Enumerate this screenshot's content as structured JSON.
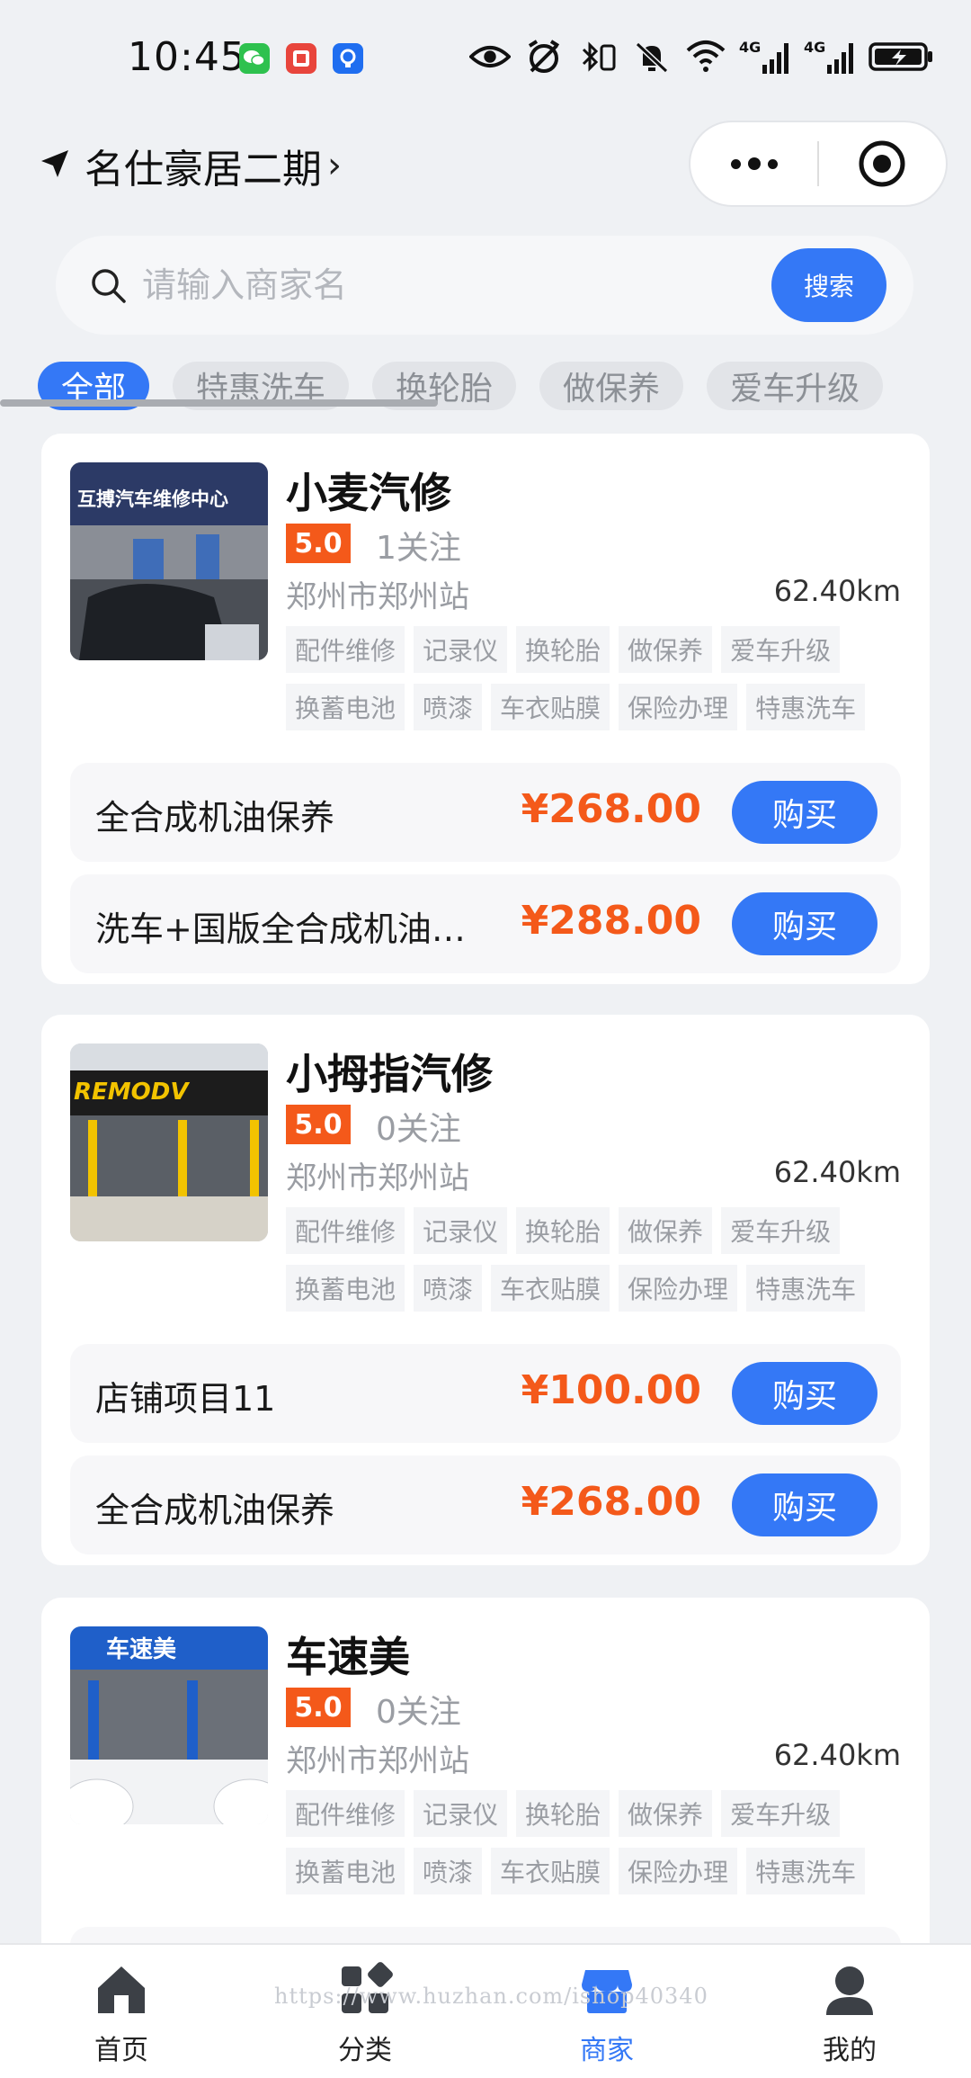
{
  "status_bar": {
    "time": "10:45",
    "app_icons": [
      {
        "name": "wechat-icon",
        "color": "#2ec14e"
      },
      {
        "name": "red-app-icon",
        "color": "#e8453c"
      },
      {
        "name": "blue-app-icon",
        "color": "#1f6ef0"
      }
    ],
    "network": [
      "4G",
      "4G"
    ]
  },
  "header": {
    "location_icon": "navigation-arrow-icon",
    "location_name": "名仕豪居二期",
    "chevron": "›"
  },
  "search": {
    "placeholder": "请输入商家名",
    "button_label": "搜索"
  },
  "categories": [
    {
      "label": "全部",
      "active": true
    },
    {
      "label": "特惠洗车",
      "active": false
    },
    {
      "label": "换轮胎",
      "active": false
    },
    {
      "label": "做保养",
      "active": false
    },
    {
      "label": "爱车升级",
      "active": false
    }
  ],
  "stores": [
    {
      "name": "小麦汽修",
      "rating": "5.0",
      "follow": "1关注",
      "address": "郑州市郑州站",
      "distance": "62.40km",
      "image_sign": "互搏汽车维修中心",
      "tags": [
        "配件维修",
        "记录仪",
        "换轮胎",
        "做保养",
        "爱车升级",
        "换蓄电池",
        "喷漆",
        "车衣贴膜",
        "保险办理",
        "特惠洗车"
      ],
      "products": [
        {
          "name": "全合成机油保养",
          "price": "¥268.00",
          "button": "购买"
        },
        {
          "name": "洗车+国版全合成机油…",
          "price": "¥288.00",
          "button": "购买"
        }
      ]
    },
    {
      "name": "小拇指汽修",
      "rating": "5.0",
      "follow": "0关注",
      "address": "郑州市郑州站",
      "distance": "62.40km",
      "image_sign": "REMODV",
      "tags": [
        "配件维修",
        "记录仪",
        "换轮胎",
        "做保养",
        "爱车升级",
        "换蓄电池",
        "喷漆",
        "车衣贴膜",
        "保险办理",
        "特惠洗车"
      ],
      "products": [
        {
          "name": "店铺项目11",
          "price": "¥100.00",
          "button": "购买"
        },
        {
          "name": "全合成机油保养",
          "price": "¥268.00",
          "button": "购买"
        }
      ]
    },
    {
      "name": "车速美",
      "rating": "5.0",
      "follow": "0关注",
      "address": "郑州市郑州站",
      "distance": "62.40km",
      "image_sign": "车速美",
      "tags": [
        "配件维修",
        "记录仪",
        "换轮胎",
        "做保养",
        "爱车升级",
        "换蓄电池",
        "喷漆",
        "车衣贴膜",
        "保险办理",
        "特惠洗车"
      ],
      "products": []
    }
  ],
  "bottom_nav": [
    {
      "label": "首页",
      "icon": "home-icon",
      "active": false
    },
    {
      "label": "分类",
      "icon": "category-icon",
      "active": false
    },
    {
      "label": "商家",
      "icon": "shop-icon",
      "active": true
    },
    {
      "label": "我的",
      "icon": "user-icon",
      "active": false
    }
  ],
  "watermark": "https://www.huzhan.com/ishop40340",
  "colors": {
    "accent": "#3478f6",
    "price": "#f4591a",
    "background": "#eff1f4"
  }
}
